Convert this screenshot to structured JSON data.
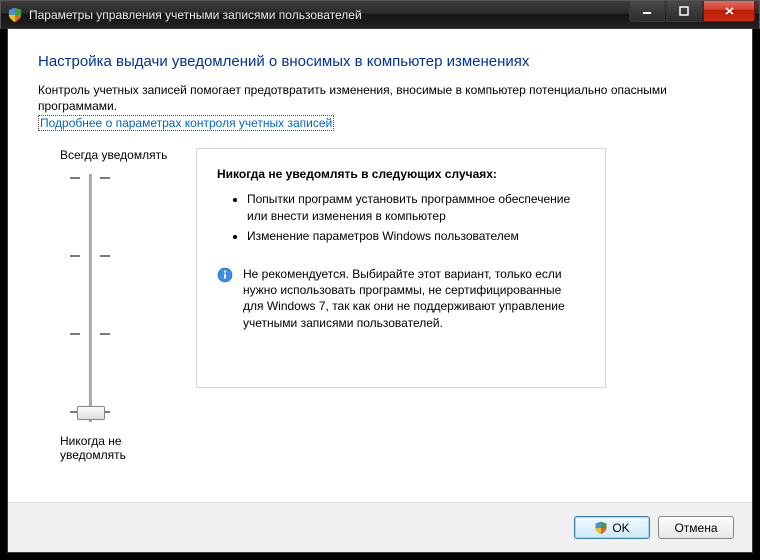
{
  "window": {
    "title": "Параметры управления учетными записями пользователей"
  },
  "page": {
    "heading": "Настройка выдачи уведомлений о вносимых в компьютер изменениях",
    "intro": "Контроль учетных записей помогает предотвратить изменения, вносимые в компьютер потенциально опасными программами.",
    "help_link": "Подробнее о параметрах контроля учетных записей"
  },
  "slider": {
    "top_label": "Всегда уведомлять",
    "bottom_label": "Никогда не уведомлять",
    "levels": 4,
    "current_level": 0
  },
  "panel": {
    "heading": "Никогда не уведомлять в следующих случаях:",
    "bullets": [
      "Попытки программ установить программное обеспечение или внести изменения в компьютер",
      "Изменение параметров Windows пользователем"
    ],
    "note": "Не рекомендуется. Выбирайте этот вариант, только если нужно использовать программы, не сертифицированные для Windows 7, так как они не поддерживают управление учетными записями пользователей."
  },
  "buttons": {
    "ok": "OK",
    "cancel": "Отмена"
  }
}
